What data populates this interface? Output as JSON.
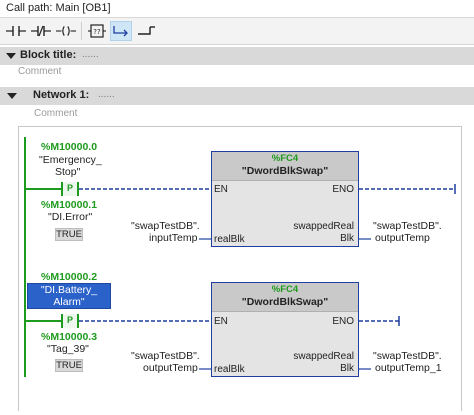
{
  "call_path": {
    "label": "Call path: Main [OB1]"
  },
  "toolbar": {
    "buttons": [
      {
        "name": "no-contact-button",
        "glyph": "⊣⊢"
      },
      {
        "name": "nc-contact-button",
        "glyph": "⊣/⊢"
      },
      {
        "name": "coil-button",
        "glyph": "–( )–"
      },
      {
        "name": "empty-box-button",
        "glyph": "??"
      },
      {
        "name": "open-branch-button",
        "glyph": "↳"
      },
      {
        "name": "close-branch-button",
        "glyph": "↲"
      }
    ]
  },
  "block": {
    "title_label": "Block title:",
    "title_dots": "......",
    "comment": "Comment"
  },
  "network": {
    "title_label": "Network 1:",
    "title_dots": "......",
    "comment": "Comment",
    "rungs": [
      {
        "contact1": {
          "address": "%M10000.0",
          "tag_line1": "\"Emergency_",
          "tag_line2": "Stop\"",
          "symbol": "P"
        },
        "contact2": {
          "address": "%M10000.1",
          "tag": "\"DI.Error\"",
          "value": "TRUE"
        },
        "block": {
          "fc": "%FC4",
          "name": "\"DwordBlkSwap\"",
          "en": "EN",
          "eno": "ENO",
          "in_pin": "realBlk",
          "out_pin_line1": "swappedReal",
          "out_pin_line2": "Blk",
          "in_var_line1": "\"swapTestDB\".",
          "in_var_line2": "inputTemp",
          "out_var_line1": "\"swapTestDB\".",
          "out_var_line2": "outputTemp"
        }
      },
      {
        "contact1": {
          "address": "%M10000.2",
          "tag_line1": "\"DI.Battery_",
          "tag_line2": "Alarm\"",
          "symbol": "P"
        },
        "contact2": {
          "address": "%M10000.3",
          "tag": "\"Tag_39\"",
          "value": "TRUE"
        },
        "block": {
          "fc": "%FC4",
          "name": "\"DwordBlkSwap\"",
          "en": "EN",
          "eno": "ENO",
          "in_pin": "realBlk",
          "out_pin_line1": "swappedReal",
          "out_pin_line2": "Blk",
          "in_var_line1": "\"swapTestDB\".",
          "in_var_line2": "outputTemp",
          "out_var_line1": "\"swapTestDB\".",
          "out_var_line2": "outputTemp_1"
        }
      }
    ]
  },
  "colors": {
    "address_green": "#1e9a1e",
    "wire_blue": "#1e3ea0",
    "selection_blue": "#2b62c9"
  }
}
